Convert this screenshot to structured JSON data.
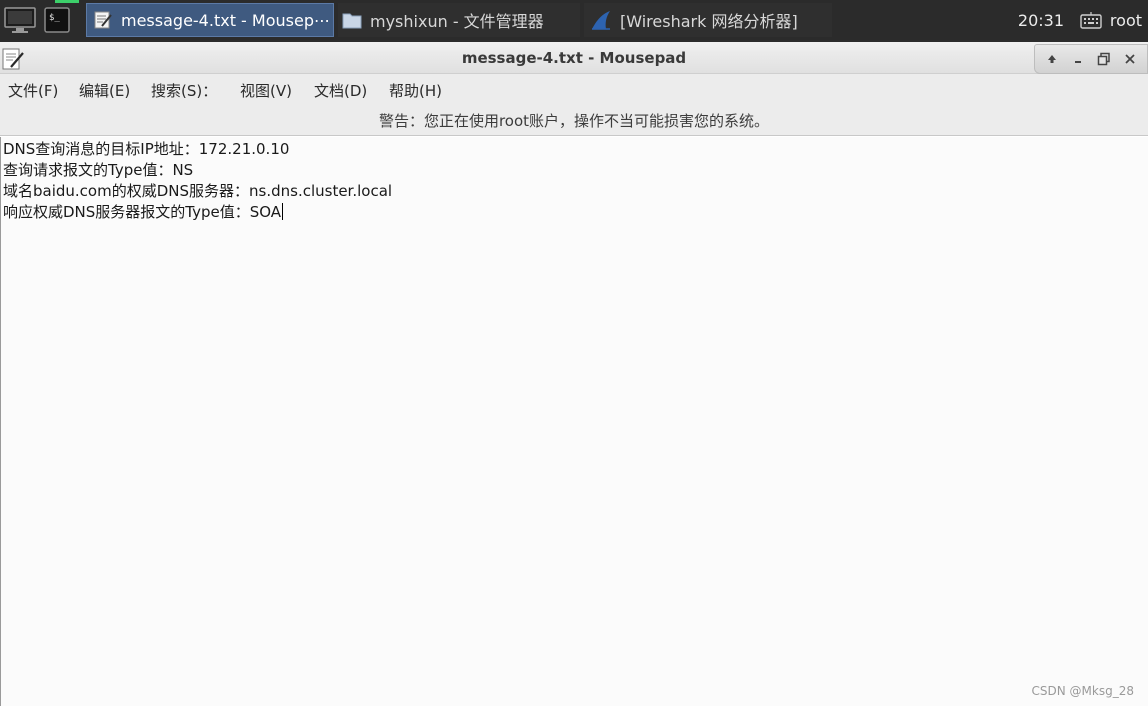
{
  "taskbar": {
    "tasks": [
      {
        "label": "message-4.txt - Mousep⋯",
        "icon": "text-editor-icon",
        "active": true
      },
      {
        "label": "myshixun - 文件管理器",
        "icon": "folder-icon",
        "active": false
      },
      {
        "label": "[Wireshark 网络分析器]",
        "icon": "wireshark-fin-icon",
        "active": false
      }
    ],
    "clock": "20:31",
    "user": "root",
    "colors": {
      "background": "#2b2b2b",
      "active_task": "#3f5a80",
      "indicator": "#3ccf6a"
    }
  },
  "window": {
    "title": "message-4.txt - Mousepad"
  },
  "menubar": {
    "items": [
      {
        "label": "文件(F)"
      },
      {
        "label": "编辑(E)"
      },
      {
        "label": "搜索(S)："
      },
      {
        "label": "视图(V)"
      },
      {
        "label": "文档(D)"
      },
      {
        "label": "帮助(H)"
      }
    ]
  },
  "warning": {
    "text": "警告：您正在使用root账户，操作不当可能损害您的系统。"
  },
  "editor": {
    "lines": [
      "DNS查询消息的目标IP地址：172.21.0.10",
      "查询请求报文的Type值：NS",
      "域名baidu.com的权威DNS服务器：ns.dns.cluster.local",
      "响应权威DNS服务器报文的Type值：SOA"
    ]
  },
  "watermark": "CSDN @Mksg_28"
}
